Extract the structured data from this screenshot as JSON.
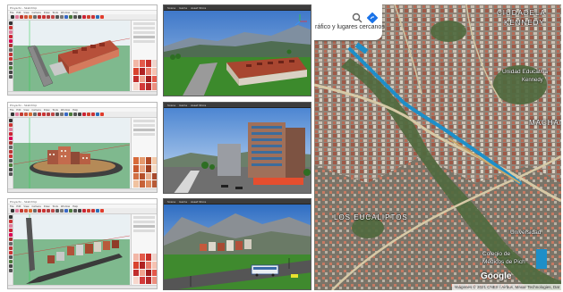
{
  "sketchup_windows": [
    {
      "title": "Proyecto - SketchUp",
      "menus": [
        "File",
        "Edit",
        "View",
        "Camera",
        "Draw",
        "Tools",
        "Window",
        "Help"
      ]
    },
    {
      "title": "Proyecto - SketchUp",
      "menus": [
        "File",
        "Edit",
        "View",
        "Camera",
        "Draw",
        "Tools",
        "Window",
        "Help"
      ]
    },
    {
      "title": "Proyecto - SketchUp",
      "menus": [
        "File",
        "Edit",
        "View",
        "Camera",
        "Draw",
        "Tools",
        "Window",
        "Help"
      ]
    }
  ],
  "engine_views": [
    {
      "tabs": [
        "Scene",
        "Game",
        "Asset Store"
      ]
    },
    {
      "tabs": [
        "Scene",
        "Game",
        "Asset Store"
      ]
    },
    {
      "tabs": [
        "Scene",
        "Game",
        "Asset Store"
      ]
    }
  ],
  "map": {
    "search_text": "ráfico y lugares cercanos",
    "labels": [
      {
        "id": "ciudadela",
        "text": "CIUDADELA"
      },
      {
        "id": "kennedy",
        "text": "KENNEDY"
      },
      {
        "id": "unidad",
        "text": "Unidad Educativa"
      },
      {
        "id": "kennedy-small",
        "text": "Kennedy"
      },
      {
        "id": "machan",
        "text": "MACHAN"
      },
      {
        "id": "eucaliptos",
        "text": "LOS EUCALIPTOS"
      },
      {
        "id": "universidad",
        "text": "Universidad"
      },
      {
        "id": "colegio",
        "text": "Colegio de"
      },
      {
        "id": "medicos",
        "text": "Médicos de Pich"
      }
    ],
    "attribution": "Imágenes © 2021 CNES / Airbus, Maxar Technologies, Dat",
    "brand": "Google"
  },
  "colors": {
    "sketch_ground": "#7fb98e",
    "engine_sky": "#5d8fd0",
    "map_road": "#d6c9a6",
    "map_rail": "#1e8fc8"
  },
  "icons": [
    "search-icon",
    "directions-icon"
  ]
}
